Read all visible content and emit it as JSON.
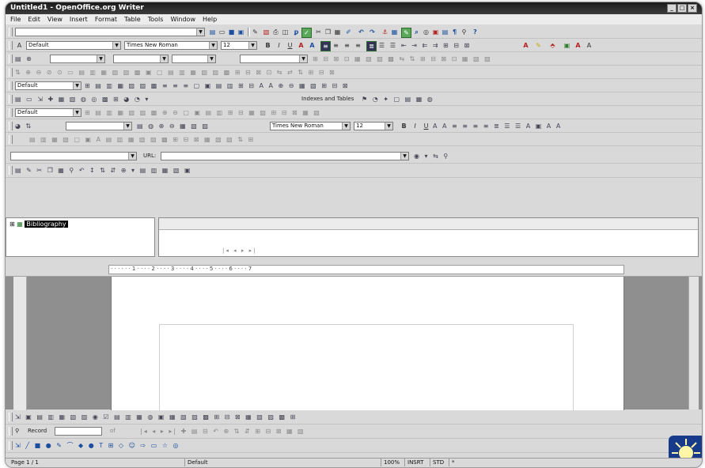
{
  "window": {
    "title": "Untitled1 - OpenOffice.org Writer",
    "buttons": {
      "minimize": "_",
      "maximize": "□",
      "close": "×"
    }
  },
  "menu": [
    "File",
    "Edit",
    "View",
    "Insert",
    "Format",
    "Table",
    "Tools",
    "Window",
    "Help"
  ],
  "formatting_toolbar": {
    "paragraph_style": "Default",
    "font_name": "Times New Roman",
    "font_size": "12"
  },
  "second_format_toolbar": {
    "paragraph_style": "Default",
    "font_name": "Times New Roman",
    "font_size": "12"
  },
  "style_box_1": "Default",
  "style_box_2": "Default",
  "insert_toolbar": {
    "indexes_label": "Indexes and Tables"
  },
  "hyperlink_bar": {
    "url_label": "URL:"
  },
  "navigator": {
    "item": "Bibliography"
  },
  "form_navigation": {
    "record_label": "Record",
    "record_of": "of"
  },
  "status_bar": {
    "page": "Page 1 / 1",
    "style": "Default",
    "zoom": "100%",
    "insert_mode": "INSRT",
    "selection_mode": "STD",
    "modified": "*"
  },
  "colors": {
    "titlebar": "#1a1a1a",
    "window_bg": "#d9d9d9",
    "document_bg": "#8f8f8f",
    "page": "#ffffff"
  },
  "icons": [
    "new-document-icon",
    "open-icon",
    "save-icon",
    "print-icon",
    "cut-icon",
    "copy-icon",
    "paste-icon",
    "undo-icon",
    "redo-icon",
    "navigator-icon",
    "gallery-icon",
    "zoom-icon",
    "help-icon",
    "bold-icon",
    "italic-icon",
    "underline-icon",
    "align-left-icon",
    "align-center-icon",
    "align-right-icon",
    "justify-icon",
    "numbering-icon",
    "bullets-icon",
    "font-color-icon",
    "highlight-icon",
    "background-color-icon",
    "draw-functions-icon",
    "sun-logo-icon"
  ]
}
